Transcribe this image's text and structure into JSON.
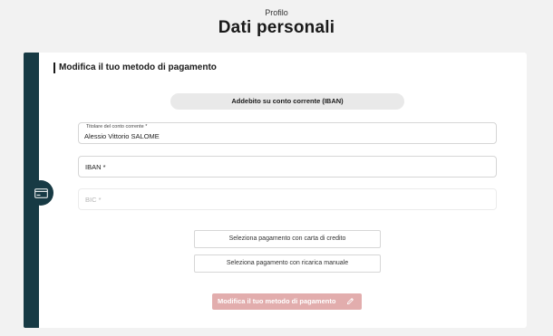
{
  "header": {
    "subtitle": "Profilo",
    "title": "Dati personali"
  },
  "card": {
    "icon": "credit-card-icon",
    "section_title": "Modifica il tuo metodo di pagamento",
    "method_label": "Addebito su conto corrente (IBAN)",
    "fields": {
      "holder": {
        "label": "Titolare del conto corrente *",
        "value": "Alessio Vittorio SALOME"
      },
      "iban": {
        "placeholder": "IBAN *"
      },
      "bic": {
        "placeholder": "BIC *"
      }
    },
    "alt_methods": {
      "credit_card_label": "Seleziona pagamento con carta di credito",
      "manual_topup_label": "Seleziona pagamento con ricarica manuale"
    },
    "submit_label": "Modifica il tuo metodo di pagamento",
    "submit_icon": "pencil-icon"
  },
  "colors": {
    "background": "#f2f2f2",
    "rail": "#173a44",
    "submit_disabled": "#e2adad"
  }
}
